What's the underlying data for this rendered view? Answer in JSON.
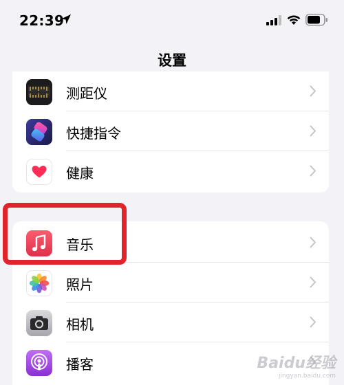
{
  "status_bar": {
    "time": "22:39",
    "icons": [
      "location-arrow-icon",
      "cellular-signal-icon",
      "wifi-icon",
      "battery-icon"
    ]
  },
  "nav": {
    "title": "设置"
  },
  "groups": [
    {
      "items": [
        {
          "label": "测距仪",
          "icon": "measure-icon"
        },
        {
          "label": "快捷指令",
          "icon": "shortcuts-icon"
        },
        {
          "label": "健康",
          "icon": "health-heart-icon"
        }
      ]
    },
    {
      "items": [
        {
          "label": "音乐",
          "icon": "music-icon",
          "highlighted": true
        },
        {
          "label": "照片",
          "icon": "photos-icon"
        },
        {
          "label": "相机",
          "icon": "camera-icon"
        },
        {
          "label": "播客",
          "icon": "podcasts-icon"
        }
      ]
    }
  ],
  "colors": {
    "background": "#f2f2f7",
    "highlight": "#e0242b",
    "music": "#f0405a",
    "podcasts": "#9b3fd8"
  },
  "watermark": {
    "brand": "Baidu经验",
    "url": "jingyan.baidu.com"
  }
}
